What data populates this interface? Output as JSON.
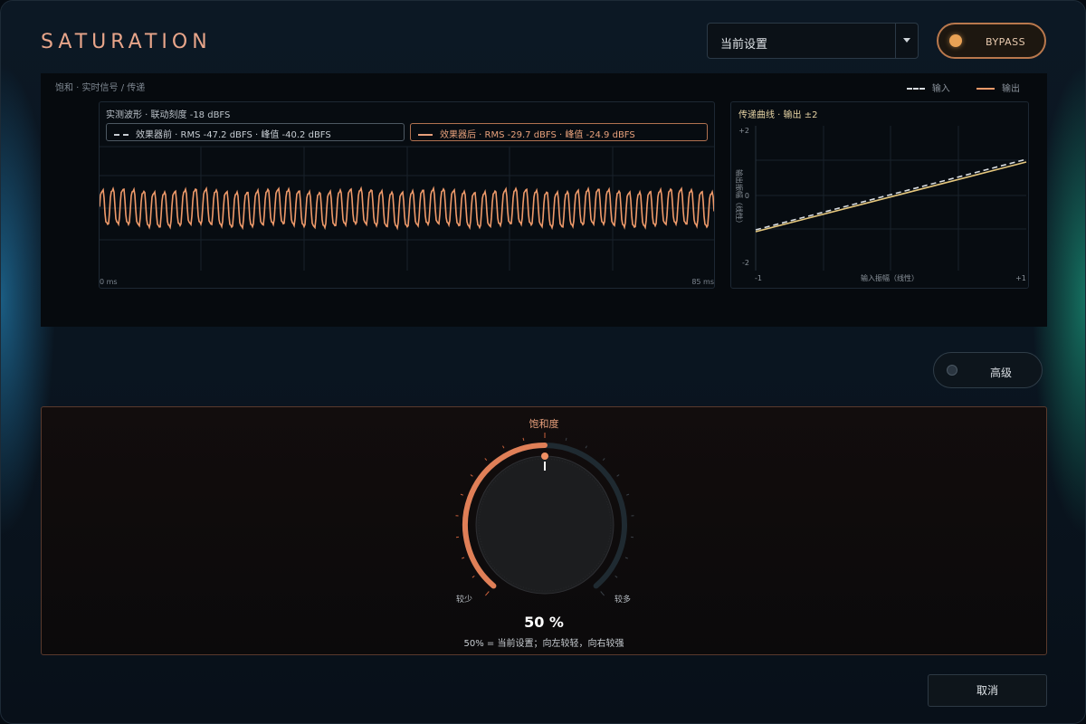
{
  "window": {
    "title": "SATURATION"
  },
  "preset": {
    "value": "当前设置"
  },
  "bypass": {
    "label": "BYPASS"
  },
  "analyzer": {
    "breadcrumb": "饱和 · 实时信号 / 传递",
    "legend": [
      {
        "label": "输入",
        "color": "#d9dde1"
      },
      {
        "label": "输出",
        "color": "#ef9a6a"
      }
    ],
    "waveform": {
      "header": "实测波形 · 联动刻度 -18 dBFS",
      "pre_label": "效果器前 · RMS -47.2 dBFS · 峰值 -40.2 dBFS",
      "post_label": "效果器后 · RMS -29.7 dBFS · 峰值 -24.9 dBFS",
      "x_start": "0 ms",
      "x_end": "85 ms",
      "color": "#ef9a6a"
    },
    "transfer": {
      "header": "传递曲线 · 输出 ±2",
      "y_label": "输出振幅（线性）",
      "x_label": "输入振幅（线性）",
      "y_ticks": [
        "+2",
        "0",
        "-2"
      ],
      "x_ticks": [
        "-1",
        "+1"
      ]
    }
  },
  "advanced": {
    "label": "高级",
    "enabled": false
  },
  "saturation": {
    "label": "饱和度",
    "min_label": "较少",
    "max_label": "较多",
    "value": 0.5,
    "value_text": "50 %",
    "hint": "50% = 当前设置；向左较轻，向右较强",
    "accent": "#e07f57"
  },
  "footer": {
    "cancel_label": "取消"
  },
  "colors": {
    "accent": "#e8a58a",
    "bypass_dot": "#e9a255"
  }
}
